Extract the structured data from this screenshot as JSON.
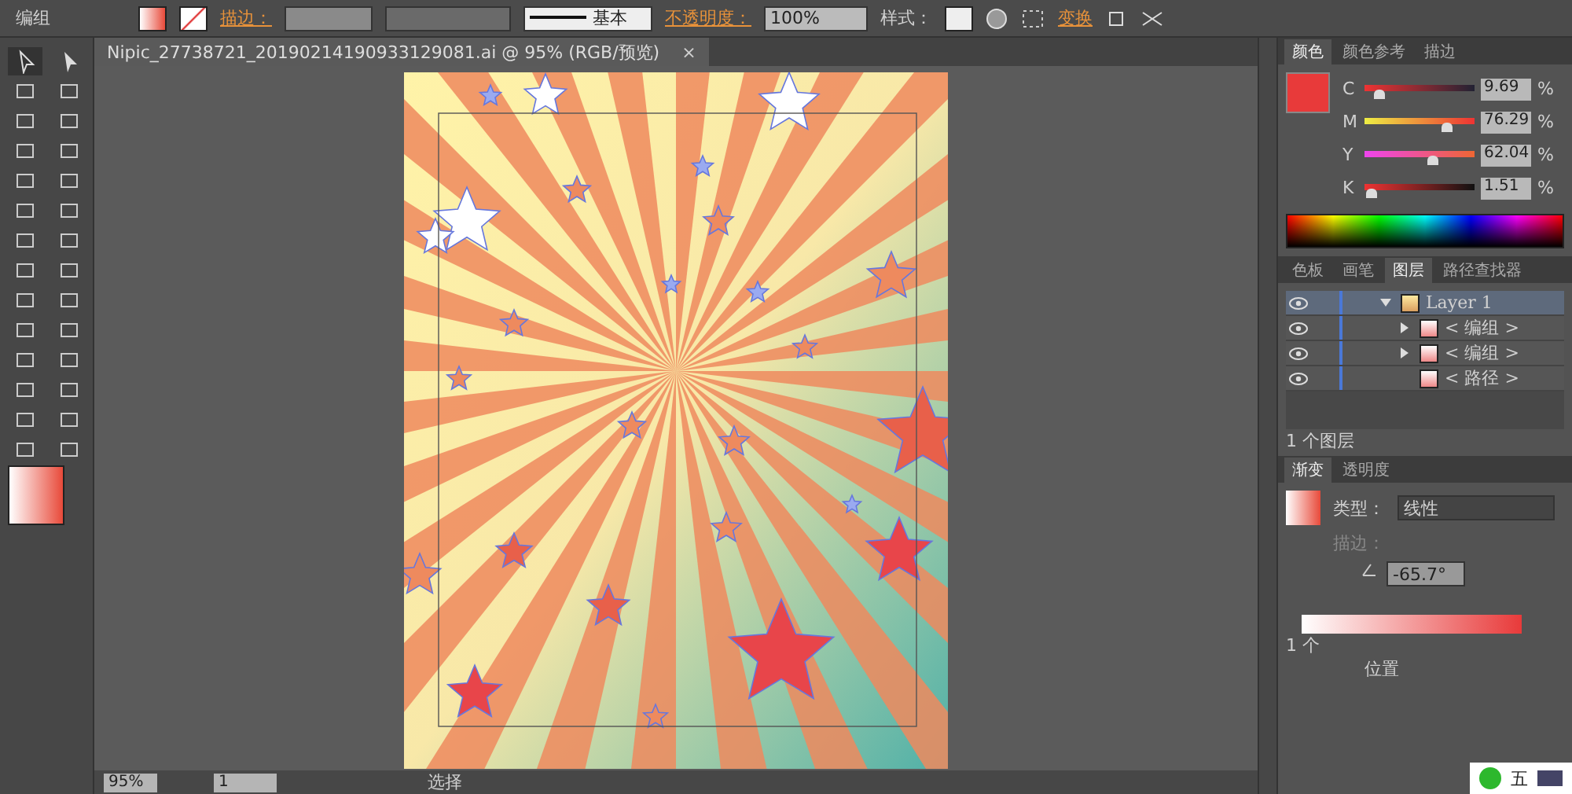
{
  "control_bar": {
    "selection_label": "编组",
    "stroke_label": "描边：",
    "stroke_profile": "基本",
    "opacity_label": "不透明度：",
    "opacity_value": "100%",
    "style_label": "样式：",
    "transform_link": "变换"
  },
  "document_tab": {
    "title": "Nipic_27738721_20190214190933129081.ai @ 95% (RGB/预览)",
    "close": "×"
  },
  "color_panel": {
    "tabs": [
      {
        "label": "颜色",
        "selected": true
      },
      {
        "label": "颜色参考",
        "selected": false
      },
      {
        "label": "描边",
        "selected": false
      }
    ],
    "sliders": [
      {
        "channel": "C",
        "level": 0.097,
        "value": "9.69",
        "unit": "%"
      },
      {
        "channel": "M",
        "level": 0.763,
        "value": "76.29",
        "unit": "%"
      },
      {
        "channel": "Y",
        "level": 0.62,
        "value": "62.04",
        "unit": "%"
      },
      {
        "channel": "K",
        "level": 0.015,
        "value": "1.51",
        "unit": "%"
      }
    ]
  },
  "layers_panel": {
    "tabs": [
      {
        "label": "色板",
        "selected": false
      },
      {
        "label": "画笔",
        "selected": false
      },
      {
        "label": "图层",
        "selected": true
      },
      {
        "label": "路径查找器",
        "selected": false
      }
    ],
    "layers": [
      {
        "name": "Layer 1",
        "visible": true,
        "expanded": true,
        "selected": true,
        "children": [
          {
            "name": "< 编组 >",
            "visible": true,
            "expanded": false,
            "selected": false
          },
          {
            "name": "< 编组 >",
            "visible": true,
            "expanded": false,
            "selected": false
          },
          {
            "name": "< 路径 >",
            "visible": true,
            "selected": false
          }
        ]
      }
    ],
    "footer": "1 个图层"
  },
  "gradient_panel": {
    "tabs": [
      {
        "label": "渐变",
        "selected": true
      },
      {
        "label": "透明度",
        "selected": false
      }
    ],
    "type_label": "类型：",
    "type_value": "线性",
    "stroke_label": "描边：",
    "angle": "-65.7°",
    "layer_count_partial": "1 个",
    "position_label": "位置"
  },
  "ime_bar": {
    "mode": "五"
  },
  "status_bar": {
    "zoom": "95%",
    "page": "1",
    "tool": "选择"
  }
}
